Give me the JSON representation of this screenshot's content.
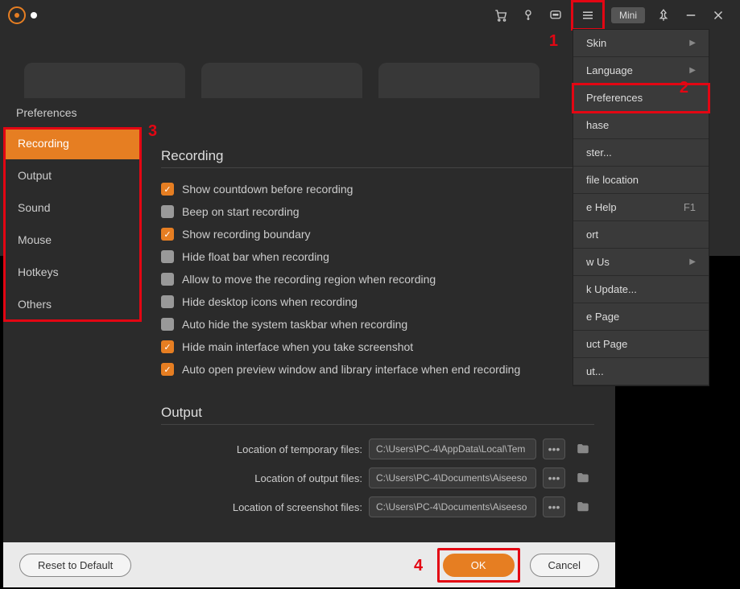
{
  "titlebar": {
    "mini_label": "Mini"
  },
  "annotations": {
    "a1": "1",
    "a2": "2",
    "a3": "3",
    "a4": "4"
  },
  "menu": {
    "items": [
      {
        "label": "Skin",
        "arrow": true
      },
      {
        "label": "Language",
        "arrow": true
      },
      {
        "label": "Preferences",
        "highlight": true
      },
      {
        "label": "hase"
      },
      {
        "label": "ster..."
      },
      {
        "label": "file location"
      },
      {
        "label": "e Help",
        "right": "F1"
      },
      {
        "label": "ort"
      },
      {
        "label": "w Us",
        "arrow": true
      },
      {
        "label": "k Update..."
      },
      {
        "label": "e Page"
      },
      {
        "label": "uct Page"
      },
      {
        "label": "ut..."
      }
    ]
  },
  "dialog": {
    "title": "Preferences",
    "sidebar": [
      "Recording",
      "Output",
      "Sound",
      "Mouse",
      "Hotkeys",
      "Others"
    ],
    "sections": {
      "recording_title": "Recording",
      "output_title": "Output",
      "checkboxes": [
        {
          "label": "Show countdown before recording",
          "on": true
        },
        {
          "label": "Beep on start recording",
          "on": false
        },
        {
          "label": "Show recording boundary",
          "on": true
        },
        {
          "label": "Hide float bar when recording",
          "on": false
        },
        {
          "label": "Allow to move the recording region when recording",
          "on": false
        },
        {
          "label": "Hide desktop icons when recording",
          "on": false
        },
        {
          "label": "Auto hide the system taskbar when recording",
          "on": false
        },
        {
          "label": "Hide main interface when you take screenshot",
          "on": true
        },
        {
          "label": "Auto open preview window and library interface when end recording",
          "on": true
        }
      ],
      "outputs": [
        {
          "label": "Location of temporary files:",
          "value": "C:\\Users\\PC-4\\AppData\\Local\\Tem"
        },
        {
          "label": "Location of output files:",
          "value": "C:\\Users\\PC-4\\Documents\\Aiseeso"
        },
        {
          "label": "Location of screenshot files:",
          "value": "C:\\Users\\PC-4\\Documents\\Aiseeso"
        }
      ]
    },
    "footer": {
      "reset": "Reset to Default",
      "ok": "OK",
      "cancel": "Cancel"
    }
  }
}
